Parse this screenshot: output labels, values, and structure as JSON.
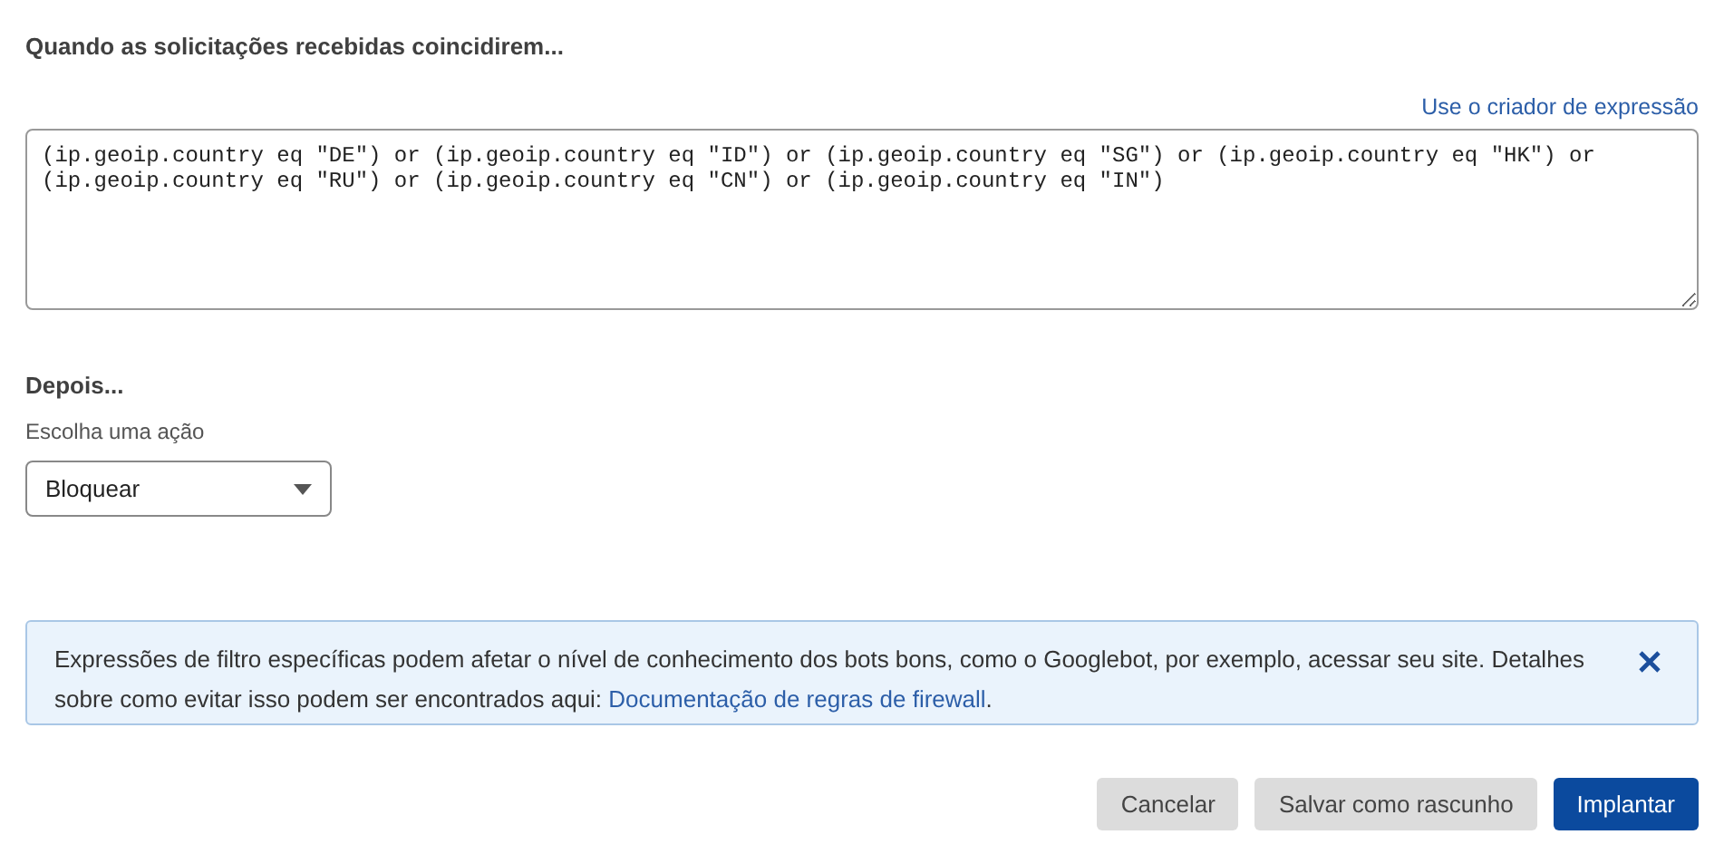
{
  "condition": {
    "heading": "Quando as solicitações recebidas coincidirem...",
    "builder_link": "Use o criador de expressão",
    "expression": "(ip.geoip.country eq \"DE\") or (ip.geoip.country eq \"ID\") or (ip.geoip.country eq \"SG\") or (ip.geoip.country eq \"HK\") or (ip.geoip.country eq \"RU\") or (ip.geoip.country eq \"CN\") or (ip.geoip.country eq \"IN\")"
  },
  "action": {
    "heading": "Depois...",
    "label": "Escolha uma ação",
    "value": "Bloquear"
  },
  "alert": {
    "text": "Expressões de filtro específicas podem afetar o nível de conhecimento dos bots bons, como o Googlebot, por exemplo, acessar seu site. Detalhes sobre como evitar isso podem ser encontrados aqui: ",
    "link": "Documentação de regras de firewall",
    "suffix": "."
  },
  "buttons": [
    {
      "label": "Cancelar",
      "kind": "secondary"
    },
    {
      "label": "Salvar como rascunho",
      "kind": "secondary"
    },
    {
      "label": "Implantar",
      "kind": "primary"
    }
  ]
}
